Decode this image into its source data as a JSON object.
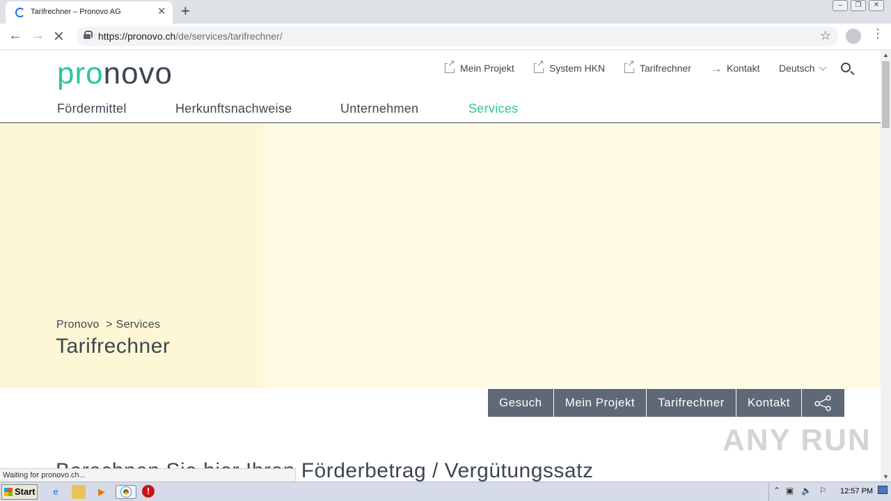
{
  "browser": {
    "tab_title": "Tarifrechner – Pronovo AG",
    "url_host": "https://pronovo.ch",
    "url_path": "/de/services/tarifrechner/",
    "status_text": "Waiting for pronovo.ch..."
  },
  "site": {
    "logo_pro": "pro",
    "logo_novo": "novo",
    "utility": [
      "Mein Projekt",
      "System HKN",
      "Tarifrechner",
      "Kontakt"
    ],
    "language": "Deutsch",
    "main_nav": [
      "Fördermittel",
      "Herkunftsnachweise",
      "Unternehmen",
      "Services"
    ],
    "active_nav": "Services"
  },
  "hero": {
    "breadcrumb_home": "Pronovo",
    "breadcrumb_sep": ">",
    "breadcrumb_current": "Services",
    "title": "Tarifrechner"
  },
  "quickbar": [
    "Gesuch",
    "Mein Projekt",
    "Tarifrechner",
    "Kontakt"
  ],
  "content": {
    "heading": "Berechnen Sie hier Ihren Förderbetrag / Vergütungssatz"
  },
  "watermark": "ANY RUN",
  "taskbar": {
    "start_label": "Start",
    "clock": "12:57 PM"
  },
  "colors": {
    "brand_green": "#2ec4a0",
    "text_dark": "#3d4650",
    "hero_bg": "#fef9e2",
    "quickbar_bg": "#5f6874"
  }
}
